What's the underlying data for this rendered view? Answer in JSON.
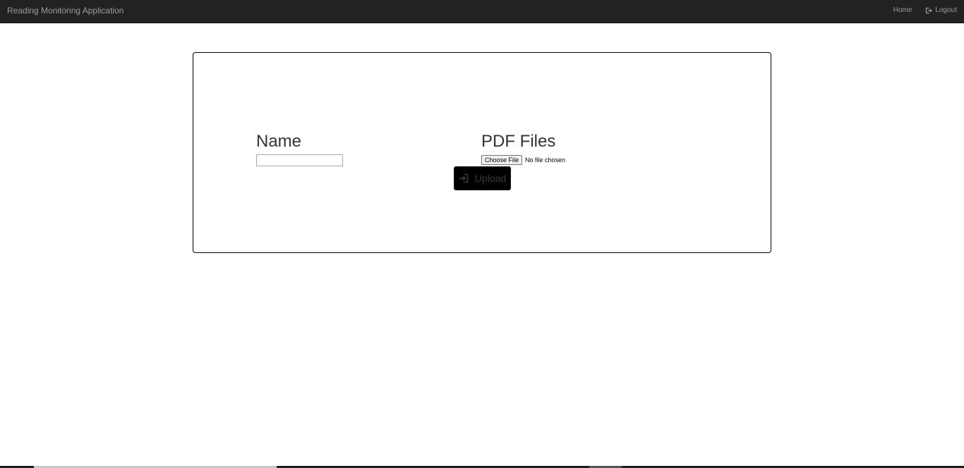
{
  "app": {
    "brand": "Reading Monitoring Application"
  },
  "nav": {
    "home_label": "Home",
    "logout_label": "Logout",
    "logout_icon": "logout-icon"
  },
  "form": {
    "name_label": "Name",
    "name_value": "",
    "pdf_label": "PDF Files",
    "choose_file_label": "Choose File",
    "file_status": "No file chosen",
    "upload_label": "Upload",
    "upload_icon": "login-icon"
  },
  "colors": {
    "navbar_bg": "#222222",
    "nav_text": "#9d9d9d",
    "upload_bg": "#000000",
    "card_border": "#000000"
  }
}
